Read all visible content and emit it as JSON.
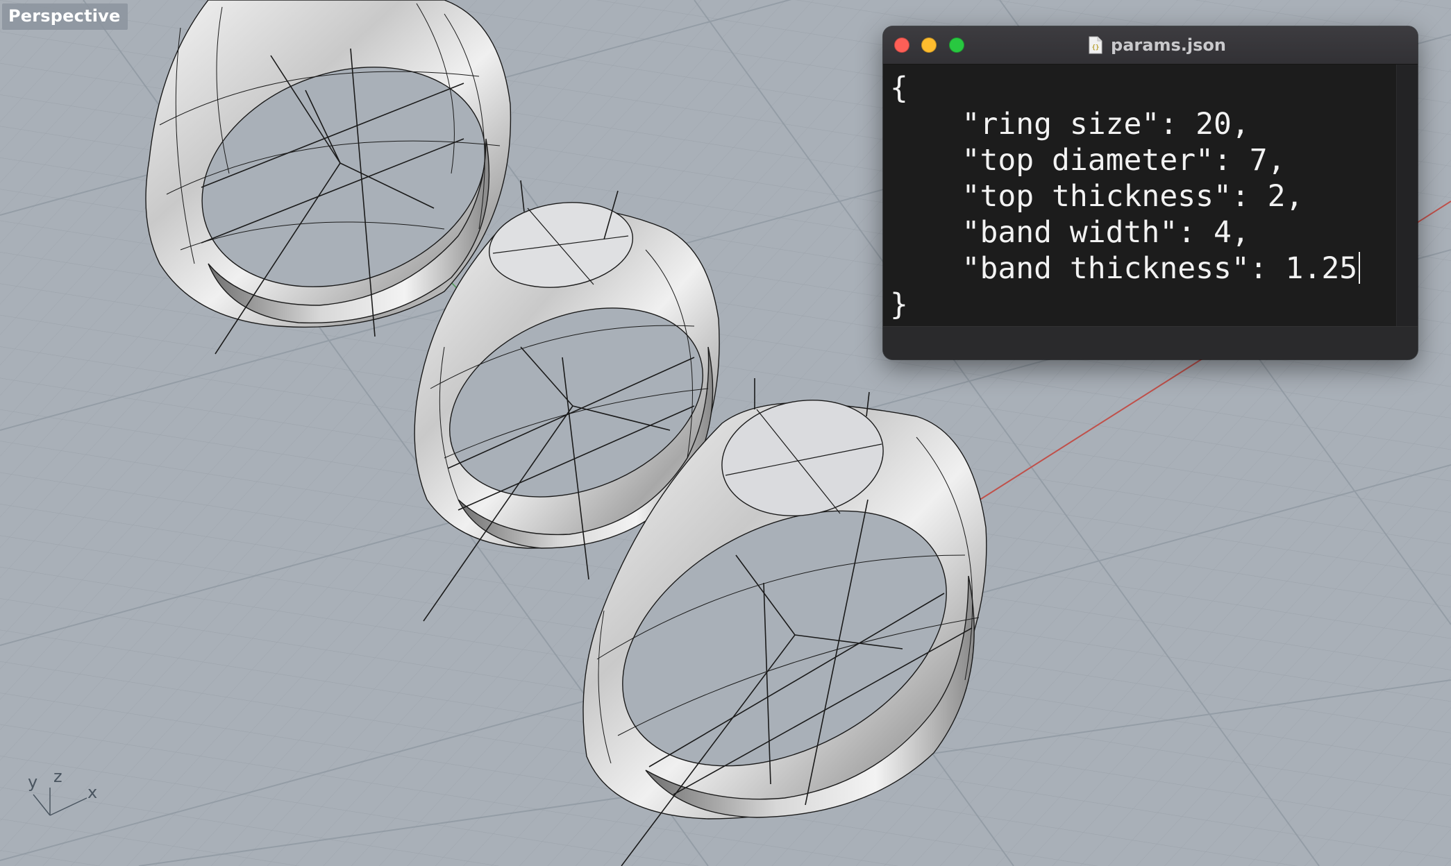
{
  "viewport": {
    "label": "Perspective",
    "axis_labels": {
      "x": "x",
      "y": "y",
      "z": "z"
    },
    "background_color": "#a9b0b8",
    "grid_color": "#9aa1a9",
    "x_axis_color": "#c0504a",
    "y_axis_color": "#4f9a55"
  },
  "editor": {
    "window_title": "params.json",
    "file_icon": "json-file-icon",
    "controls": [
      "close-button",
      "minimize-button",
      "zoom-button"
    ],
    "lines": [
      "{",
      "    \"ring size\": 20,",
      "    \"top diameter\": 7,",
      "    \"top thickness\": 2,",
      "    \"band width\": 4,",
      "    \"band thickness\": 1.25",
      "}"
    ]
  }
}
